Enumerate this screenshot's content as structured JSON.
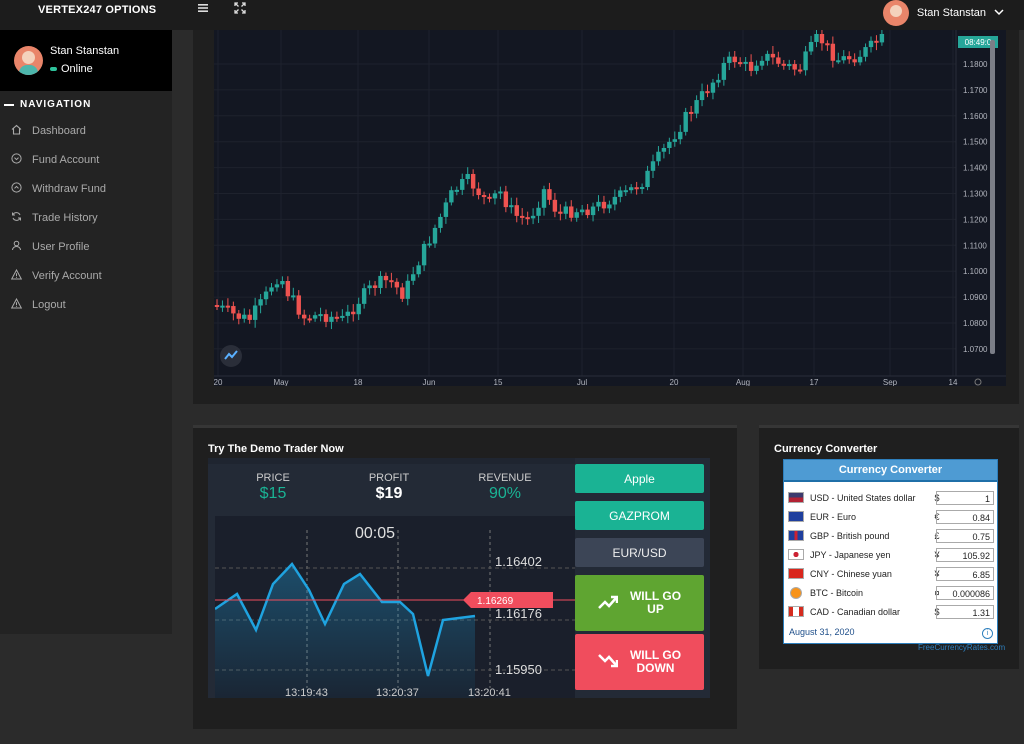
{
  "topbar": {
    "brand": "VERTEX247 OPTIONS",
    "user_name": "Stan Stanstan",
    "menu_icon": "hamburger-icon",
    "fullscreen_icon": "expand-icon",
    "dropdown_icon": "chevron-down-icon"
  },
  "sidebar": {
    "user_name": "Stan Stanstan",
    "status": "Online",
    "nav_heading": "NAVIGATION",
    "items": [
      {
        "label": "Dashboard",
        "icon": "home-icon"
      },
      {
        "label": "Fund Account",
        "icon": "circle-chevron-down-icon"
      },
      {
        "label": "Withdraw Fund",
        "icon": "circle-chevron-up-icon"
      },
      {
        "label": "Trade History",
        "icon": "refresh-icon"
      },
      {
        "label": "User Profile",
        "icon": "user-icon"
      },
      {
        "label": "Verify Account",
        "icon": "warning-icon"
      },
      {
        "label": "Logout",
        "icon": "warning-icon"
      }
    ]
  },
  "main_chart": {
    "price_badge": "08:49:0",
    "y_ticks": [
      "1.1800",
      "1.1700",
      "1.1600",
      "1.1500",
      "1.1400",
      "1.1300",
      "1.1200",
      "1.1100",
      "1.1000",
      "1.0900",
      "1.0800",
      "1.0700"
    ],
    "x_ticks": [
      "20",
      "May",
      "18",
      "Jun",
      "15",
      "Jul",
      "20",
      "Aug",
      "17",
      "Sep",
      "14"
    ],
    "colors": {
      "up": "#26a69a",
      "down": "#ef5350",
      "background": "#131722"
    }
  },
  "demo": {
    "title": "Try The Demo Trader Now",
    "price_label": "PRICE",
    "price_value": "$15",
    "profit_label": "PROFIT",
    "profit_value": "$19",
    "revenue_label": "REVENUE",
    "revenue_value": "90%",
    "timer": "00:05",
    "y_labels": [
      "1.16402",
      "1.16176",
      "1.15950"
    ],
    "current_price": "1.16269",
    "x_labels": [
      "13:19:43",
      "13:20:37",
      "13:20:41"
    ],
    "assets": [
      "Apple",
      "GAZPROM",
      "EUR/USD"
    ],
    "up_label": [
      "WILL GO",
      "UP"
    ],
    "down_label": [
      "WILL GO",
      "DOWN"
    ],
    "colors": {
      "green": "#1ab394",
      "up": "#5fa531",
      "down": "#f04d5d",
      "line": "#1fa3e0"
    }
  },
  "converter": {
    "panel_title": "Currency Converter",
    "box_title": "Currency Converter",
    "rows": [
      {
        "name": "USD - United States dollar",
        "symbol": "$",
        "value": "1"
      },
      {
        "name": "EUR - Euro",
        "symbol": "€",
        "value": "0.84"
      },
      {
        "name": "GBP - British pound",
        "symbol": "£",
        "value": "0.75"
      },
      {
        "name": "JPY - Japanese yen",
        "symbol": "¥",
        "value": "105.92"
      },
      {
        "name": "CNY - Chinese yuan",
        "symbol": "¥",
        "value": "6.85"
      },
      {
        "name": "BTC - Bitcoin",
        "symbol": "¤",
        "value": "0.000086"
      },
      {
        "name": "CAD - Canadian dollar",
        "symbol": "$",
        "value": "1.31"
      }
    ],
    "date": "August 31, 2020",
    "info": "i",
    "credit": "FreeCurrencyRates.com"
  }
}
